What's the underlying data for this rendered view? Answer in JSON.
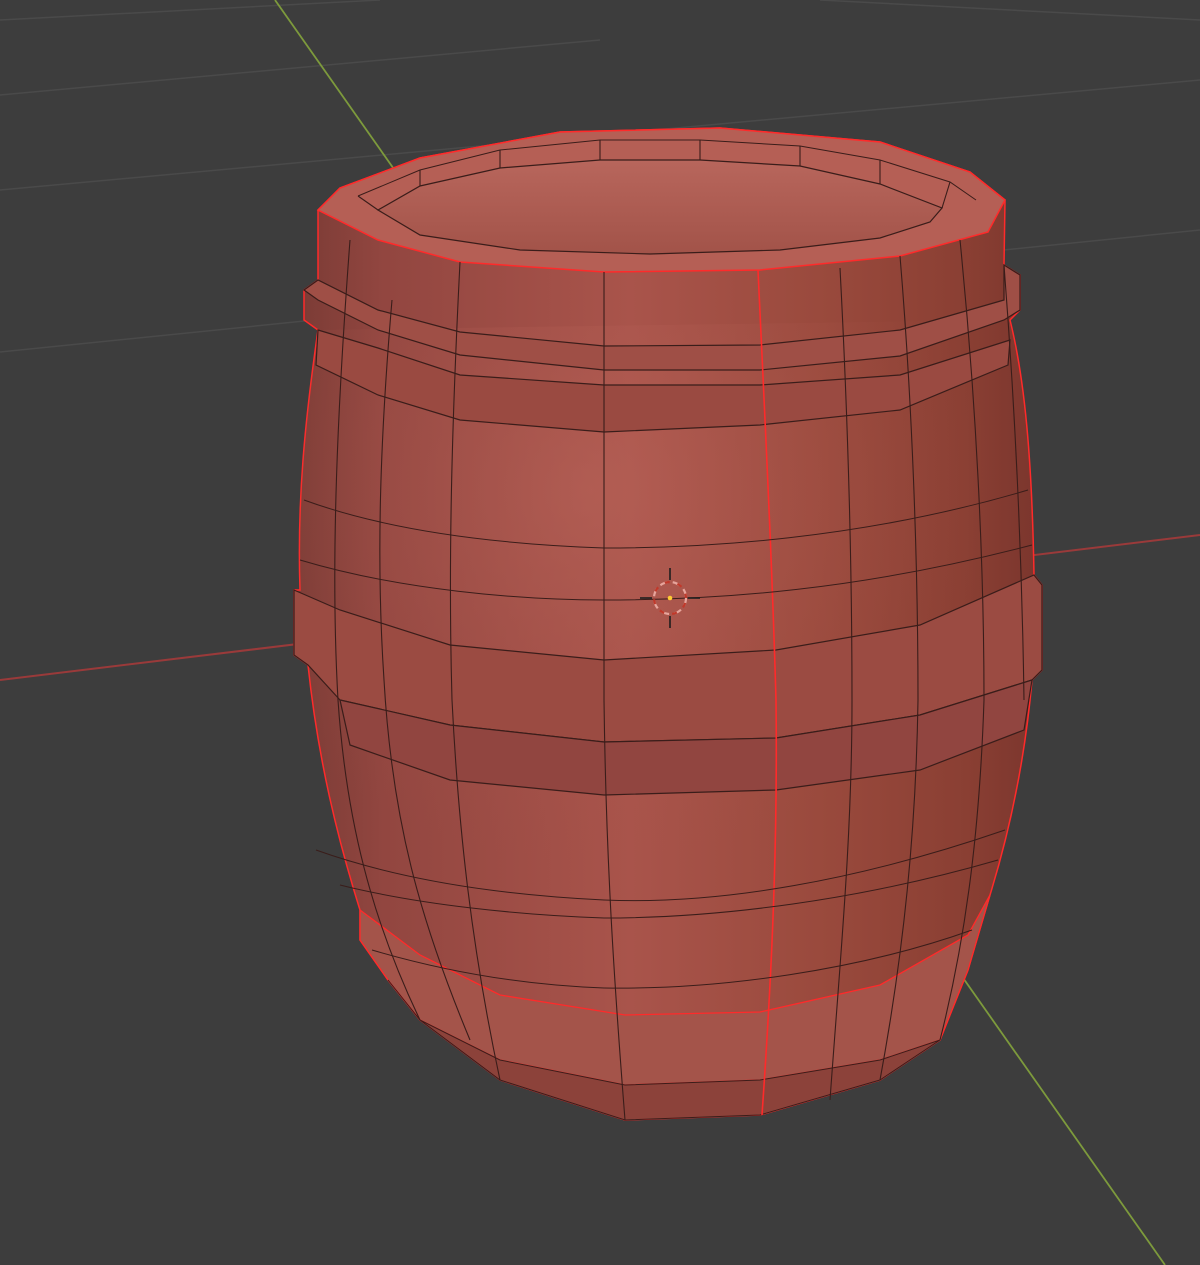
{
  "viewport": {
    "background": "#3d3d3d",
    "grid_color": "#4a4a4a",
    "x_axis_color": "#9a3a3a",
    "y_axis_color": "#7d9a3c"
  },
  "barrel": {
    "body_color": "#a9544b",
    "selected_edge_color": "#ff2a2a",
    "wire_color": "#3a1d1a"
  },
  "cursor_3d": {
    "icon": "3d-cursor-icon",
    "ring_color": "#e7a59c",
    "ring_dash_color": "#c0392b"
  }
}
